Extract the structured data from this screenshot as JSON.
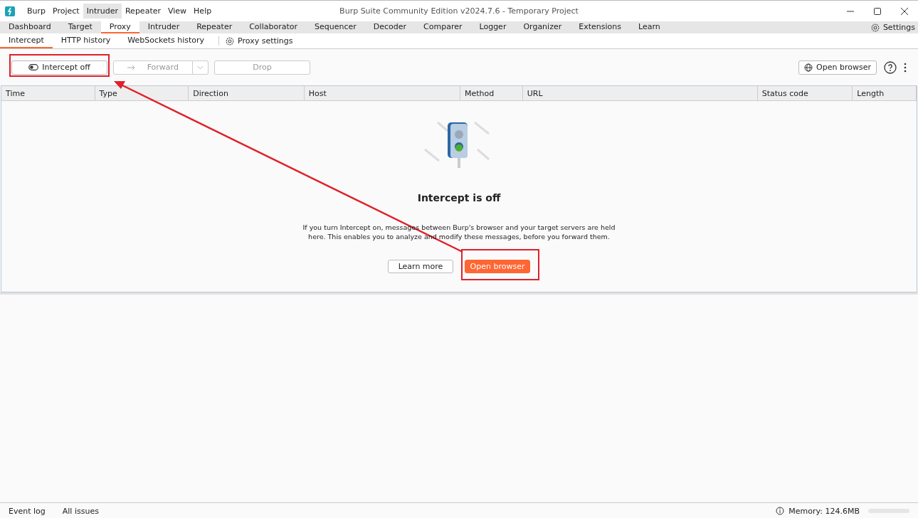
{
  "window": {
    "title": "Burp Suite Community Edition v2024.7.6 - Temporary Project"
  },
  "menu": [
    {
      "label": "Burp",
      "highlighted": false
    },
    {
      "label": "Project",
      "highlighted": false
    },
    {
      "label": "Intruder",
      "highlighted": true
    },
    {
      "label": "Repeater",
      "highlighted": false
    },
    {
      "label": "View",
      "highlighted": false
    },
    {
      "label": "Help",
      "highlighted": false
    }
  ],
  "tabs": [
    {
      "label": "Dashboard",
      "selected": false
    },
    {
      "label": "Target",
      "selected": false
    },
    {
      "label": "Proxy",
      "selected": true
    },
    {
      "label": "Intruder",
      "selected": false
    },
    {
      "label": "Repeater",
      "selected": false
    },
    {
      "label": "Collaborator",
      "selected": false
    },
    {
      "label": "Sequencer",
      "selected": false
    },
    {
      "label": "Decoder",
      "selected": false
    },
    {
      "label": "Comparer",
      "selected": false
    },
    {
      "label": "Logger",
      "selected": false
    },
    {
      "label": "Organizer",
      "selected": false
    },
    {
      "label": "Extensions",
      "selected": false
    },
    {
      "label": "Learn",
      "selected": false
    }
  ],
  "settings_button": "Settings",
  "subtabs": [
    {
      "label": "Intercept",
      "selected": true
    },
    {
      "label": "HTTP history",
      "selected": false
    },
    {
      "label": "WebSockets history",
      "selected": false
    }
  ],
  "proxy_settings": "Proxy settings",
  "toolbar": {
    "intercept": "Intercept off",
    "forward": "Forward",
    "drop": "Drop",
    "open_browser": "Open browser"
  },
  "table": {
    "columns": [
      "Time",
      "Type",
      "Direction",
      "Host",
      "Method",
      "URL",
      "Status code",
      "Length"
    ]
  },
  "empty_state": {
    "title": "Intercept is off",
    "text": "If you turn Intercept on, messages between Burp's browser and your target servers are held here. This enables you to analyze and modify these messages, before you forward them.",
    "learn_more": "Learn more",
    "open_browser": "Open browser"
  },
  "status_bar": {
    "left": [
      "Event log",
      "All issues"
    ],
    "memory": "Memory: 124.6MB"
  }
}
